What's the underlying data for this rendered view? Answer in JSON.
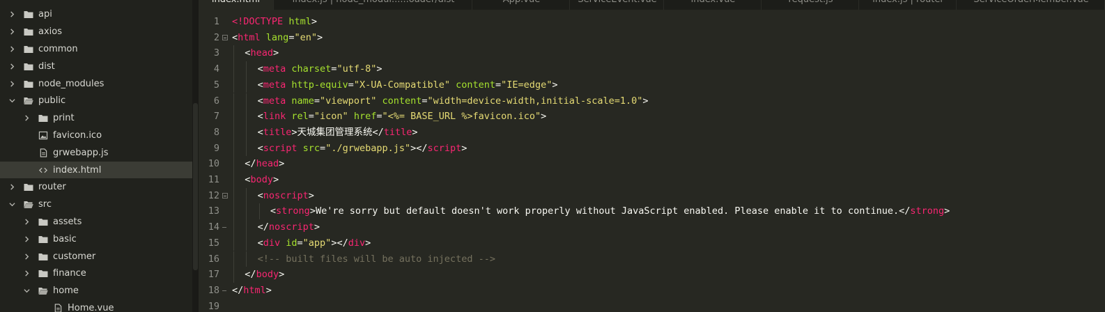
{
  "colors": {
    "tag": "#f92672",
    "attribute": "#a6e22e",
    "string": "#e6db74",
    "plain": "#f8f8f2",
    "comment": "#75715e",
    "line_number": "#8f908a",
    "editor_background": "#272822",
    "sidebar_background": "#21221d"
  },
  "sidebar": {
    "items": [
      {
        "label": "api",
        "type": "folder",
        "state": "collapsed",
        "depth": 0
      },
      {
        "label": "axios",
        "type": "folder",
        "state": "collapsed",
        "depth": 0
      },
      {
        "label": "common",
        "type": "folder",
        "state": "collapsed",
        "depth": 0
      },
      {
        "label": "dist",
        "type": "folder",
        "state": "collapsed",
        "depth": 0
      },
      {
        "label": "node_modules",
        "type": "folder",
        "state": "collapsed",
        "depth": 0
      },
      {
        "label": "public",
        "type": "folder",
        "state": "expanded",
        "depth": 0
      },
      {
        "label": "print",
        "type": "folder",
        "state": "collapsed",
        "depth": 1
      },
      {
        "label": "favicon.ico",
        "type": "image-file",
        "depth": 1
      },
      {
        "label": "grwebapp.js",
        "type": "file",
        "depth": 1
      },
      {
        "label": "index.html",
        "type": "code-file",
        "depth": 1,
        "selected": true
      },
      {
        "label": "router",
        "type": "folder",
        "state": "collapsed",
        "depth": 0
      },
      {
        "label": "src",
        "type": "folder",
        "state": "expanded",
        "depth": 0
      },
      {
        "label": "assets",
        "type": "folder",
        "state": "collapsed",
        "depth": 1
      },
      {
        "label": "basic",
        "type": "folder",
        "state": "collapsed",
        "depth": 1
      },
      {
        "label": "customer",
        "type": "folder",
        "state": "collapsed",
        "depth": 1
      },
      {
        "label": "finance",
        "type": "folder",
        "state": "collapsed",
        "depth": 1
      },
      {
        "label": "home",
        "type": "folder",
        "state": "expanded",
        "depth": 1
      },
      {
        "label": "Home.vue",
        "type": "file",
        "depth": 2
      }
    ]
  },
  "tabs": [
    {
      "label": "index.html",
      "active": true
    },
    {
      "label": "index.js | node_modul......oader/dist",
      "active": false
    },
    {
      "label": "App.vue",
      "active": false
    },
    {
      "label": "ServiceEvent.vue",
      "active": false
    },
    {
      "label": "index.vue",
      "active": false
    },
    {
      "label": "request.js",
      "active": false
    },
    {
      "label": "index.js | router",
      "active": false
    },
    {
      "label": "ServiceOrderMember.vue",
      "active": false
    }
  ],
  "editor": {
    "lines": [
      {
        "number": "1",
        "indent": 0,
        "fold": "",
        "tokens": [
          [
            "tag",
            "<!"
          ],
          [
            "tag",
            "DOCTYPE"
          ],
          [
            "t",
            " "
          ],
          [
            "attr",
            "html"
          ],
          [
            "t",
            ">"
          ]
        ]
      },
      {
        "number": "2",
        "indent": 0,
        "fold": "open",
        "tokens": [
          [
            "t",
            "<"
          ],
          [
            "tag",
            "html"
          ],
          [
            "t",
            " "
          ],
          [
            "attr",
            "lang"
          ],
          [
            "t",
            "="
          ],
          [
            "str",
            "\"en\""
          ],
          [
            "t",
            ">"
          ]
        ]
      },
      {
        "number": "3",
        "indent": 1,
        "fold": "",
        "tokens": [
          [
            "t",
            "<"
          ],
          [
            "tag",
            "head"
          ],
          [
            "t",
            ">"
          ]
        ]
      },
      {
        "number": "4",
        "indent": 2,
        "fold": "",
        "tokens": [
          [
            "t",
            "<"
          ],
          [
            "tag",
            "meta"
          ],
          [
            "t",
            " "
          ],
          [
            "attr",
            "charset"
          ],
          [
            "t",
            "="
          ],
          [
            "str",
            "\"utf-8\""
          ],
          [
            "t",
            ">"
          ]
        ]
      },
      {
        "number": "5",
        "indent": 2,
        "fold": "",
        "tokens": [
          [
            "t",
            "<"
          ],
          [
            "tag",
            "meta"
          ],
          [
            "t",
            " "
          ],
          [
            "attr",
            "http-equiv"
          ],
          [
            "t",
            "="
          ],
          [
            "str",
            "\"X-UA-Compatible\""
          ],
          [
            "t",
            " "
          ],
          [
            "attr",
            "content"
          ],
          [
            "t",
            "="
          ],
          [
            "str",
            "\"IE=edge\""
          ],
          [
            "t",
            ">"
          ]
        ]
      },
      {
        "number": "6",
        "indent": 2,
        "fold": "",
        "tokens": [
          [
            "t",
            "<"
          ],
          [
            "tag",
            "meta"
          ],
          [
            "t",
            " "
          ],
          [
            "attr",
            "name"
          ],
          [
            "t",
            "="
          ],
          [
            "str",
            "\"viewport\""
          ],
          [
            "t",
            " "
          ],
          [
            "attr",
            "content"
          ],
          [
            "t",
            "="
          ],
          [
            "str",
            "\"width=device-width,initial-scale=1.0\""
          ],
          [
            "t",
            ">"
          ]
        ]
      },
      {
        "number": "7",
        "indent": 2,
        "fold": "",
        "tokens": [
          [
            "t",
            "<"
          ],
          [
            "tag",
            "link"
          ],
          [
            "t",
            " "
          ],
          [
            "attr",
            "rel"
          ],
          [
            "t",
            "="
          ],
          [
            "str",
            "\"icon\""
          ],
          [
            "t",
            " "
          ],
          [
            "attr",
            "href"
          ],
          [
            "t",
            "="
          ],
          [
            "str",
            "\"<%= BASE_URL %>favicon.ico\""
          ],
          [
            "t",
            ">"
          ]
        ]
      },
      {
        "number": "8",
        "indent": 2,
        "fold": "",
        "tokens": [
          [
            "t",
            "<"
          ],
          [
            "tag",
            "title"
          ],
          [
            "t",
            ">天城集团管理系统</"
          ],
          [
            "tag",
            "title"
          ],
          [
            "t",
            ">"
          ]
        ]
      },
      {
        "number": "9",
        "indent": 2,
        "fold": "",
        "tokens": [
          [
            "t",
            "<"
          ],
          [
            "tag",
            "script"
          ],
          [
            "t",
            " "
          ],
          [
            "attr",
            "src"
          ],
          [
            "t",
            "="
          ],
          [
            "str",
            "\"./grwebapp.js\""
          ],
          [
            "t",
            "></"
          ],
          [
            "tag",
            "script"
          ],
          [
            "t",
            ">"
          ]
        ]
      },
      {
        "number": "10",
        "indent": 1,
        "fold": "",
        "tokens": [
          [
            "t",
            "</"
          ],
          [
            "tag",
            "head"
          ],
          [
            "t",
            ">"
          ]
        ]
      },
      {
        "number": "11",
        "indent": 1,
        "fold": "",
        "tokens": [
          [
            "t",
            "<"
          ],
          [
            "tag",
            "body"
          ],
          [
            "t",
            ">"
          ]
        ]
      },
      {
        "number": "12",
        "indent": 2,
        "fold": "open",
        "tokens": [
          [
            "t",
            "<"
          ],
          [
            "tag",
            "noscript"
          ],
          [
            "t",
            ">"
          ]
        ]
      },
      {
        "number": "13",
        "indent": 3,
        "fold": "",
        "tokens": [
          [
            "t",
            "<"
          ],
          [
            "tag",
            "strong"
          ],
          [
            "t",
            ">We're sorry but default doesn't work properly without JavaScript enabled. Please enable it to continue.</"
          ],
          [
            "tag",
            "strong"
          ],
          [
            "t",
            ">"
          ]
        ]
      },
      {
        "number": "14",
        "indent": 2,
        "fold": "end",
        "tokens": [
          [
            "t",
            "</"
          ],
          [
            "tag",
            "noscript"
          ],
          [
            "t",
            ">"
          ]
        ]
      },
      {
        "number": "15",
        "indent": 2,
        "fold": "",
        "tokens": [
          [
            "t",
            "<"
          ],
          [
            "tag",
            "div"
          ],
          [
            "t",
            " "
          ],
          [
            "attr",
            "id"
          ],
          [
            "t",
            "="
          ],
          [
            "str",
            "\"app\""
          ],
          [
            "t",
            "></"
          ],
          [
            "tag",
            "div"
          ],
          [
            "t",
            ">"
          ]
        ]
      },
      {
        "number": "16",
        "indent": 2,
        "fold": "",
        "tokens": [
          [
            "comment",
            "<!-- built files will be auto injected -->"
          ]
        ]
      },
      {
        "number": "17",
        "indent": 1,
        "fold": "",
        "tokens": [
          [
            "t",
            "</"
          ],
          [
            "tag",
            "body"
          ],
          [
            "t",
            ">"
          ]
        ]
      },
      {
        "number": "18",
        "indent": 0,
        "fold": "end",
        "tokens": [
          [
            "t",
            "</"
          ],
          [
            "tag",
            "html"
          ],
          [
            "t",
            ">"
          ]
        ]
      },
      {
        "number": "19",
        "indent": 0,
        "fold": "",
        "tokens": []
      }
    ]
  }
}
